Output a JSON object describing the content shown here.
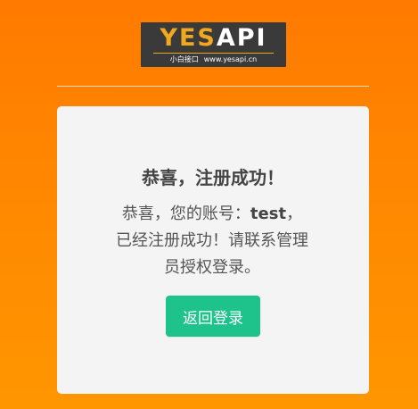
{
  "logo": {
    "brand_yes": "YES",
    "brand_api": "API",
    "tagline_cn": "小白接口",
    "tagline_url": "www.yesapi.cn"
  },
  "card": {
    "title": "恭喜，注册成功！",
    "message_prefix": "恭喜，您的账号：",
    "username": "test",
    "message_suffix": "，已经注册成功！请联系管理员授权登录。",
    "button_label": "返回登录"
  },
  "colors": {
    "background_top": "#ff7a00",
    "background_bottom": "#ff9600",
    "logo_bg": "#3a3a3a",
    "logo_accent": "#f0a81e",
    "card_bg": "#f4f4f4",
    "button_bg": "#1ec28b"
  }
}
